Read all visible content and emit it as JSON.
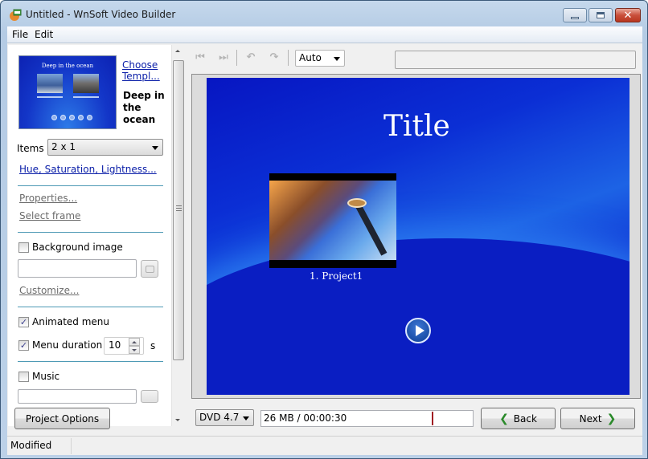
{
  "window": {
    "title": "Untitled - WnSoft Video Builder",
    "controls": {
      "minimize": "minimize",
      "maximize": "maximize",
      "close": "close"
    }
  },
  "menu": {
    "items": [
      "File",
      "Edit"
    ]
  },
  "left_panel": {
    "template": {
      "thumbnail_title": "Deep in the ocean",
      "choose_link_line1": "Choose",
      "choose_link_line2": "Templ...",
      "name_line1": "Deep in",
      "name_line2": "the",
      "name_line3": "ocean"
    },
    "items": {
      "label": "Items",
      "value": "2 x 1"
    },
    "hsl_link": "Hue, Saturation, Lightness...",
    "properties_link": "Properties...",
    "select_frame_link": "Select frame",
    "background_image": {
      "label": "Background image",
      "checked": false,
      "path": ""
    },
    "customize_link": "Customize...",
    "animated_menu": {
      "label": "Animated menu",
      "checked": true
    },
    "menu_duration": {
      "label": "Menu duration",
      "checked": true,
      "value": "10",
      "unit": "s"
    },
    "music": {
      "label": "Music",
      "checked": false,
      "path": ""
    },
    "check_glyph": "✓"
  },
  "toolbar": {
    "zoom_select": "Auto",
    "icons": [
      "prev-frame-icon",
      "next-frame-icon",
      "undo-icon",
      "redo-icon"
    ]
  },
  "preview": {
    "title": "Title",
    "items": [
      {
        "caption": "1. Project1"
      }
    ]
  },
  "bottom": {
    "project_options": "Project Options",
    "disc_select": "DVD 4.7",
    "size_info": "26 MB / 00:00:30",
    "capacity_used_fraction": 0.805,
    "back": "Back",
    "next": "Next",
    "back_glyph": "❮",
    "next_glyph": "❯"
  },
  "status": {
    "text": "Modified"
  }
}
